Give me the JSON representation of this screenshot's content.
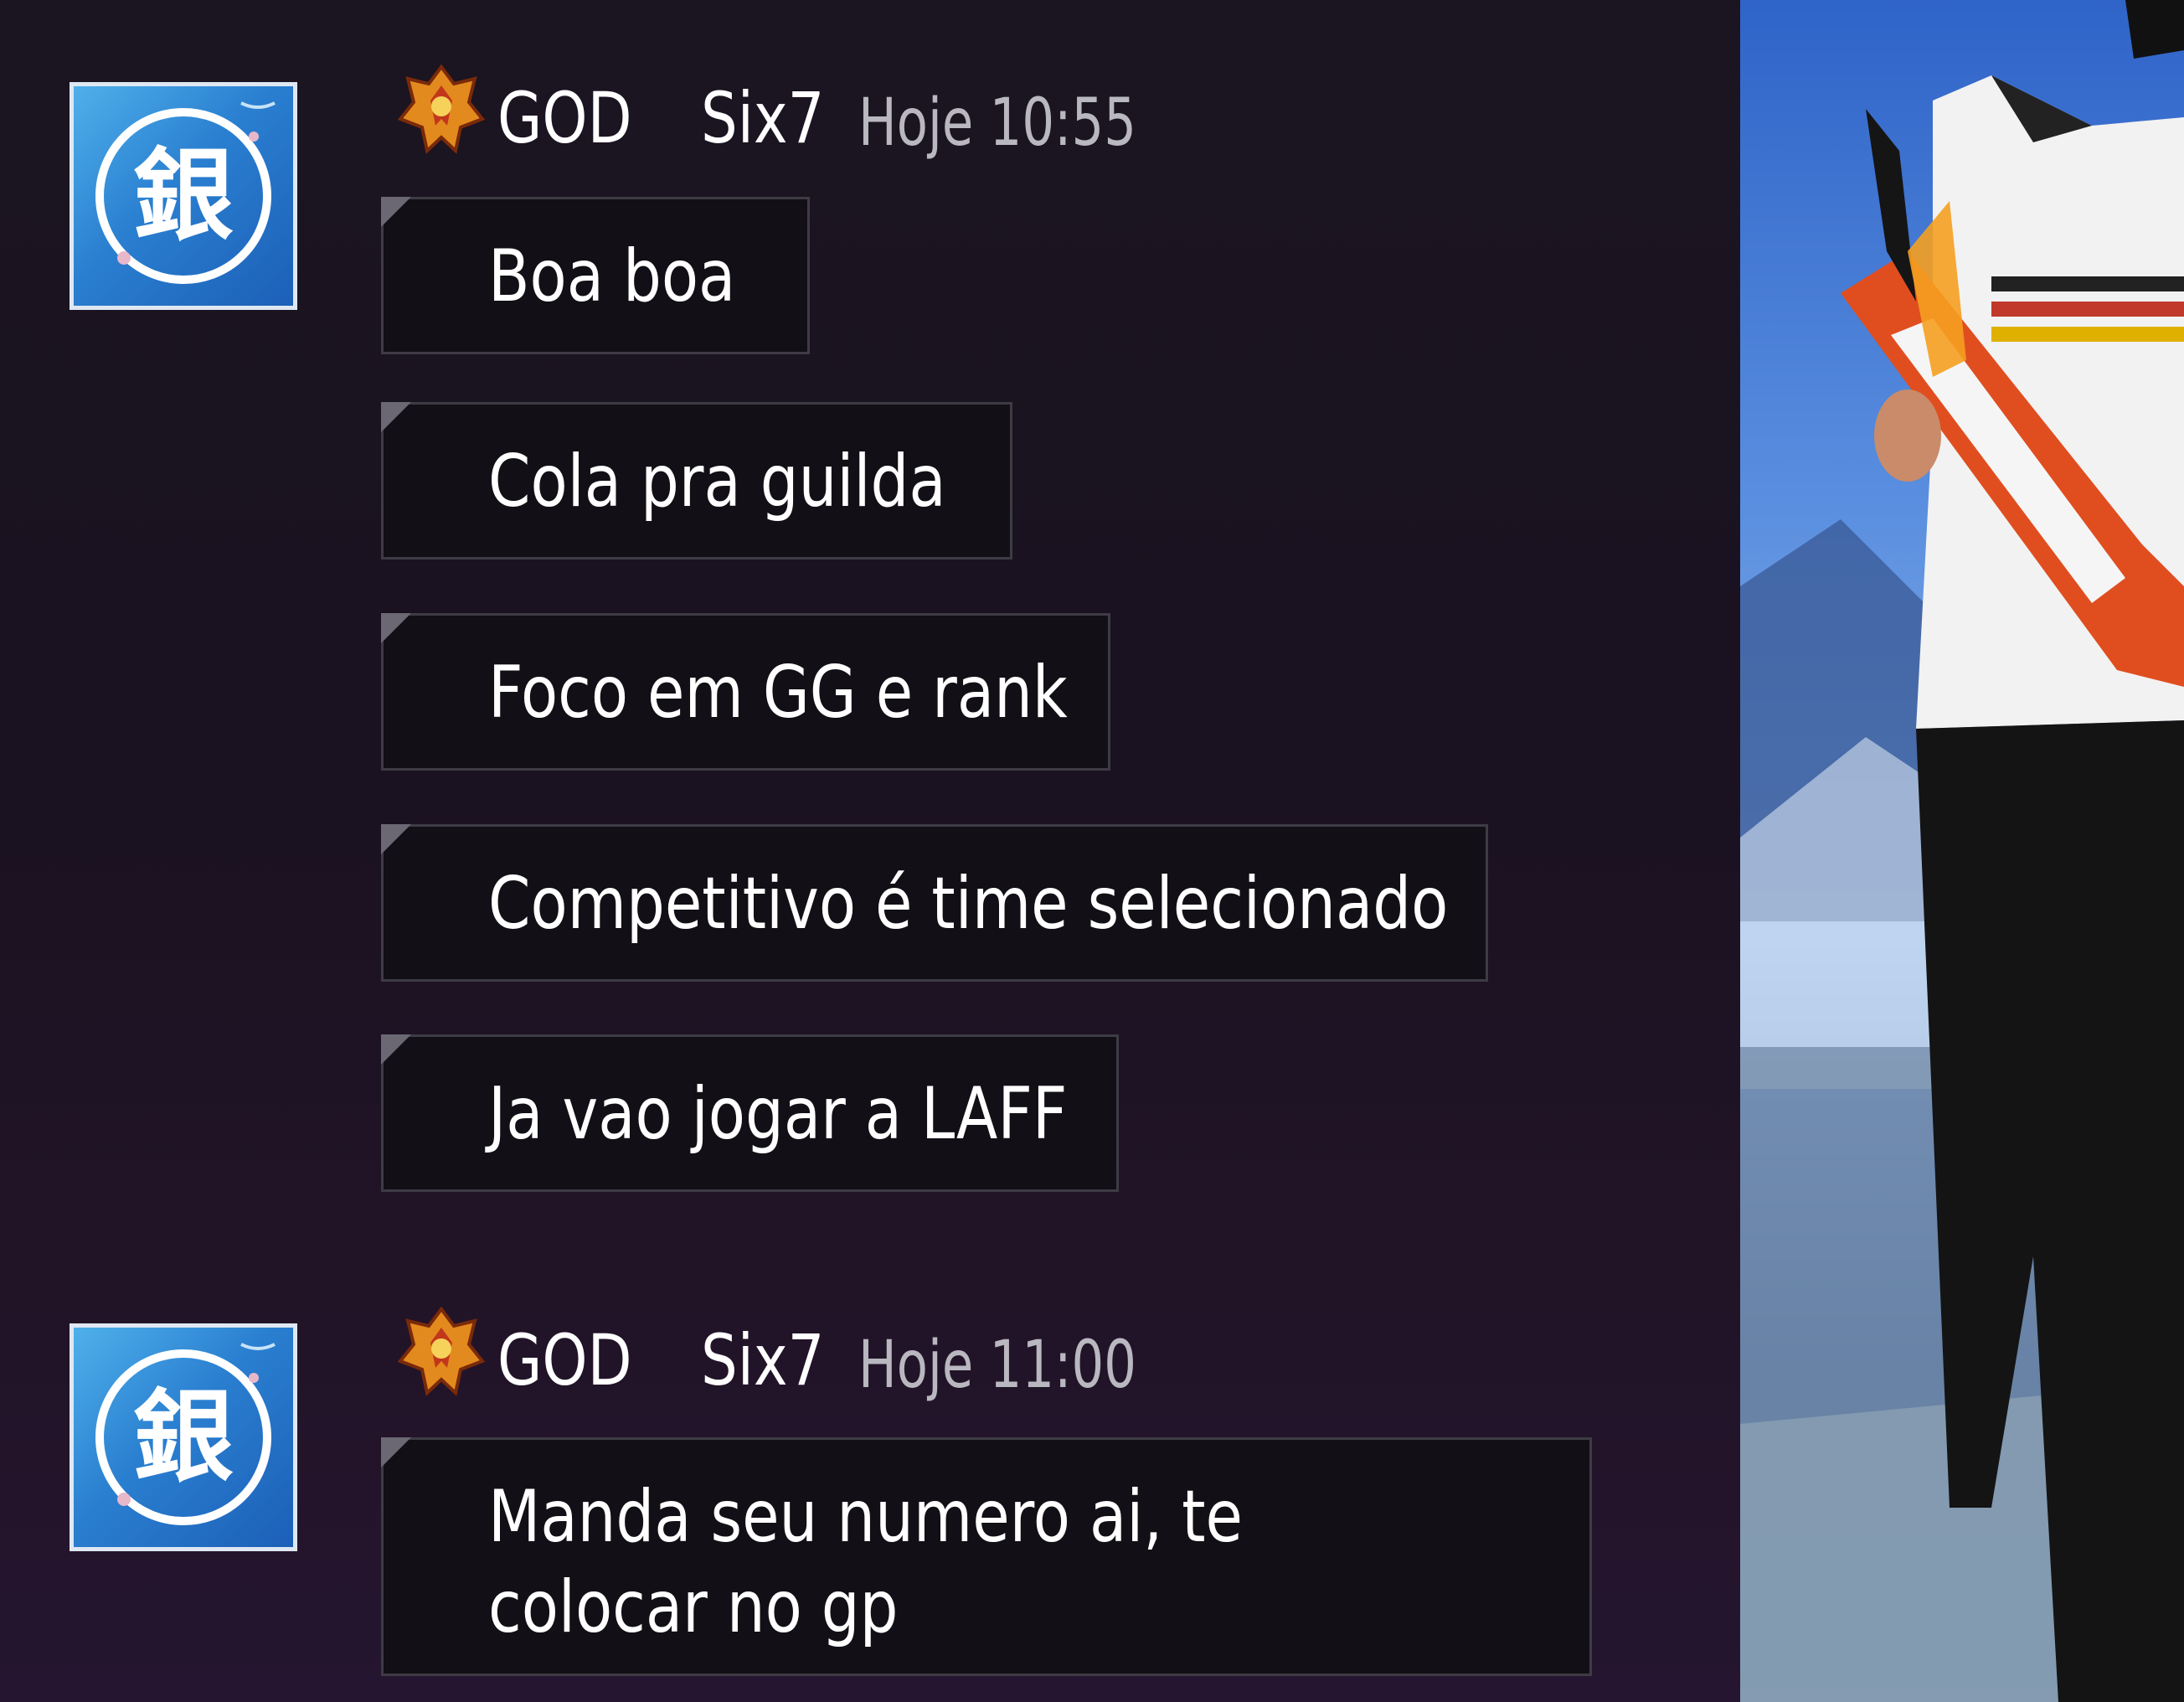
{
  "messages": [
    {
      "avatar_glyph": "銀",
      "rank_icon": "rank-emblem-icon",
      "username": "GOD",
      "name2": "Six7",
      "time": "Hoje 10:55",
      "bubbles": [
        "Boa boa",
        "Cola pra guilda",
        "Foco em GG e rank",
        "Competitivo é time selecionado",
        "Ja vao jogar a LAFF"
      ]
    },
    {
      "avatar_glyph": "銀",
      "rank_icon": "rank-emblem-icon",
      "username": "GOD",
      "name2": "Six7",
      "time": "Hoje 11:00",
      "bubbles": [
        "Manda seu numero ai, te colocar no gp"
      ]
    }
  ],
  "colors": {
    "background": "#1a1220",
    "bubble": "#121016",
    "bubble_border": "#3e3b45",
    "timestamp": "#b9b7bf",
    "avatar_blue": "#2a7fd0"
  },
  "game_scene": {
    "icon": "game-character-icon"
  }
}
